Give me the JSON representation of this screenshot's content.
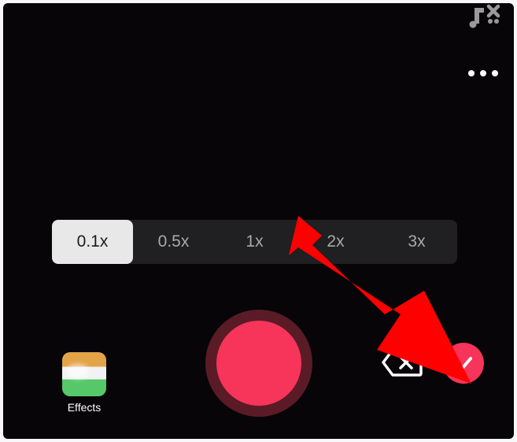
{
  "speeds": {
    "items": [
      "0.1x",
      "0.5x",
      "1x",
      "2x",
      "3x"
    ],
    "active_index": 0
  },
  "effects": {
    "label": "Effects"
  },
  "colors": {
    "record": "#f73459",
    "record_ring": "#5a1b27",
    "background": "#070508"
  },
  "annotation": {
    "arrow_color": "#ff0000"
  }
}
